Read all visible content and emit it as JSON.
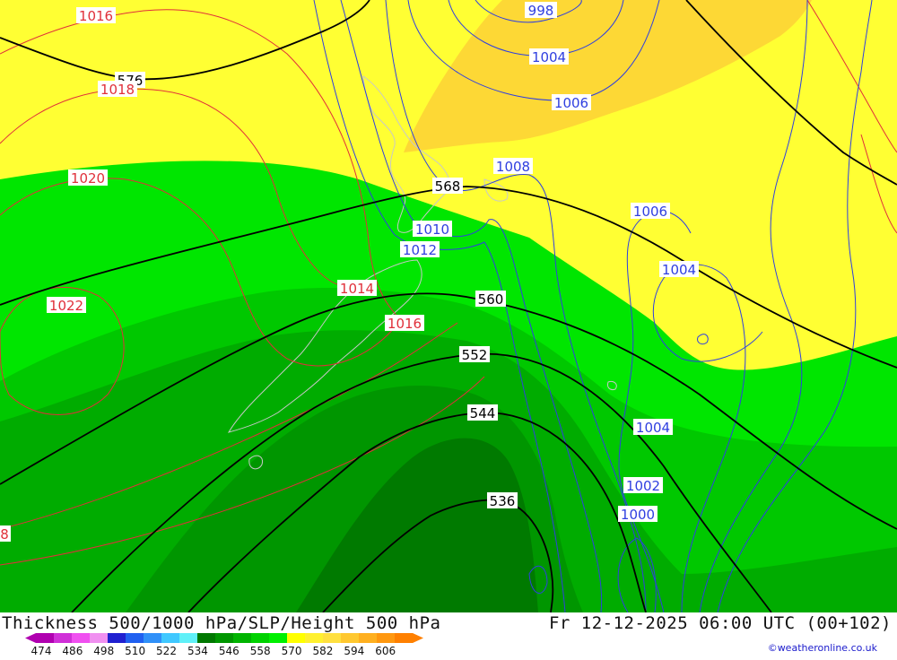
{
  "title": "Thickness 500/1000 hPa/SLP/Height 500 hPa",
  "timestamp": "Fr 12-12-2025 06:00 UTC (00+102)",
  "credit": "©weatheronline.co.uk",
  "colors": {
    "land_outline": "#c8c8c8",
    "slp_high": "#e0303a",
    "slp_low": "#2f3fe0",
    "height_line": "#000000"
  },
  "thickness_zones": [
    {
      "range": "576-582",
      "color": "#fdd835"
    },
    {
      "range": "570-576",
      "color": "#ffff33"
    },
    {
      "range": "558-564",
      "color": "#00e600"
    },
    {
      "range": "552-558",
      "color": "#00c800"
    },
    {
      "range": "546-552",
      "color": "#00ac00"
    },
    {
      "range": "540-546",
      "color": "#009600"
    },
    {
      "range": "534-540",
      "color": "#007a00"
    }
  ],
  "height_labels": [
    "576",
    "568",
    "560",
    "552",
    "544",
    "536"
  ],
  "slp_high_labels": [
    "1016",
    "1018",
    "1020",
    "1022",
    "1014",
    "1016",
    "8"
  ],
  "slp_low_labels": [
    "998",
    "1004",
    "1006",
    "1008",
    "1010",
    "1012",
    "1006",
    "1004",
    "1004",
    "1002",
    "1000"
  ],
  "legend": {
    "ticks": [
      "474",
      "486",
      "498",
      "510",
      "522",
      "534",
      "546",
      "558",
      "570",
      "582",
      "594",
      "606"
    ],
    "colors": [
      "#b000b0",
      "#d030d8",
      "#f050f0",
      "#f090f0",
      "#2020d0",
      "#2060f0",
      "#3090f8",
      "#40c8ff",
      "#60f0f8",
      "#007800",
      "#009600",
      "#00b400",
      "#00d200",
      "#00f000",
      "#ffff00",
      "#fff030",
      "#ffe040",
      "#ffc830",
      "#ffb020",
      "#ff9810",
      "#ff8000"
    ]
  }
}
